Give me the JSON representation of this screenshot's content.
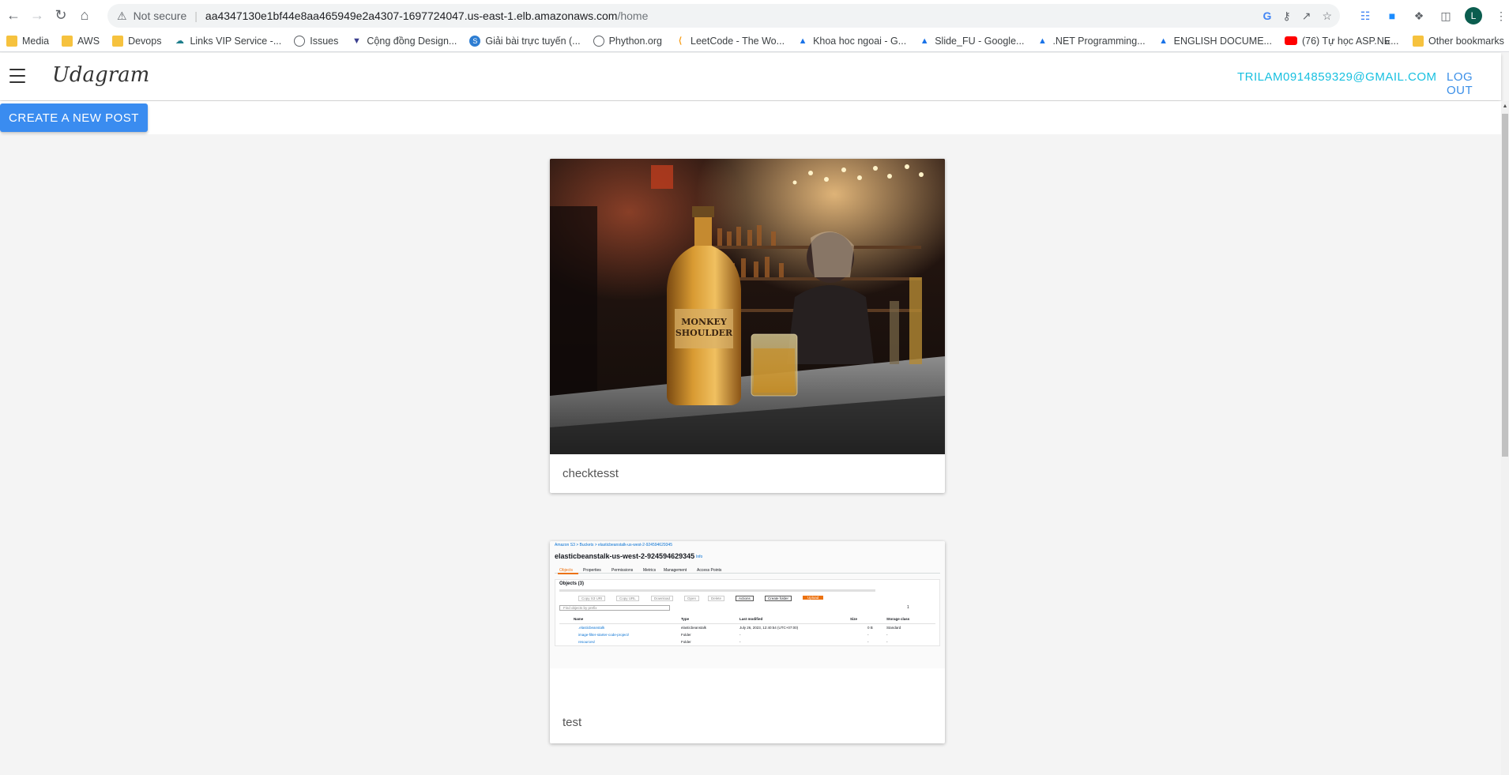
{
  "browser": {
    "url_security": "Not secure",
    "url_host": "aa4347130e1bf44e8aa465949e2a4307-1697724047.us-east-1.elb.amazonaws.com",
    "url_path": "/home",
    "profile_initial": "L",
    "bookmarks": [
      {
        "label": "Media",
        "icon": "folder-icon"
      },
      {
        "label": "AWS",
        "icon": "folder-icon"
      },
      {
        "label": "Devops",
        "icon": "folder-icon"
      },
      {
        "label": "Links VIP Service -...",
        "icon": "cloud-icon"
      },
      {
        "label": "Issues",
        "icon": "globe-icon"
      },
      {
        "label": "Cộng đồng Design...",
        "icon": "shield-icon"
      },
      {
        "label": "Giải bài trực tuyến (...",
        "icon": "site-icon"
      },
      {
        "label": "Phython.org",
        "icon": "globe-icon"
      },
      {
        "label": "LeetCode - The Wo...",
        "icon": "leetcode-icon"
      },
      {
        "label": "Khoa hoc ngoai - G...",
        "icon": "drive-icon"
      },
      {
        "label": "Slide_FU - Google...",
        "icon": "drive-icon"
      },
      {
        "label": ".NET Programming...",
        "icon": "drive-icon"
      },
      {
        "label": "ENGLISH DOCUME...",
        "icon": "drive-icon"
      },
      {
        "label": "(76) Tự học ASP.NE...",
        "icon": "youtube-icon"
      }
    ],
    "bookmarks_overflow": "»",
    "other_bookmarks": "Other bookmarks"
  },
  "app": {
    "brand": "Udagram",
    "user_email": "TRILAM0914859329@GMAIL.COM",
    "logout_label": "LOG OUT",
    "create_post_label": "CREATE A NEW POST"
  },
  "posts": [
    {
      "caption": "checktesst",
      "image": "whisky-bottle-bar-photo"
    },
    {
      "caption": "test",
      "image": "s3-bucket-screenshot"
    }
  ],
  "s3_shot": {
    "breadcrumb": "Amazon S3 > Buckets > elasticbeanstalk-us-west-2-924594629345",
    "bucket_title": "elasticbeanstalk-us-west-2-924594629345",
    "info_badge": "Info",
    "tabs": [
      "Objects",
      "Properties",
      "Permissions",
      "Metrics",
      "Management",
      "Access Points"
    ],
    "objects_heading": "Objects (3)",
    "buttons": [
      "Copy S3 URI",
      "Copy URL",
      "Download",
      "Open",
      "Delete",
      "Actions",
      "Create folder",
      "Upload"
    ],
    "search_placeholder": "Find objects by prefix",
    "pager": "1",
    "columns": [
      "Name",
      "Type",
      "Last modified",
      "Size",
      "Storage class"
    ],
    "rows": [
      {
        "name": ".elasticbeanstalk",
        "type": "elasticbeanstalk",
        "modified": "July 26, 2023, 12:40:54 (UTC+07:00)",
        "size": "0 B",
        "storage": "Standard"
      },
      {
        "name": "image-filter-starter-code-project/",
        "type": "Folder",
        "modified": "-",
        "size": "-",
        "storage": "-"
      },
      {
        "name": "resources/",
        "type": "Folder",
        "modified": "-",
        "size": "-",
        "storage": "-"
      }
    ]
  },
  "photo_label": {
    "line1": "MONKEY",
    "line2": "SHOULDER"
  }
}
